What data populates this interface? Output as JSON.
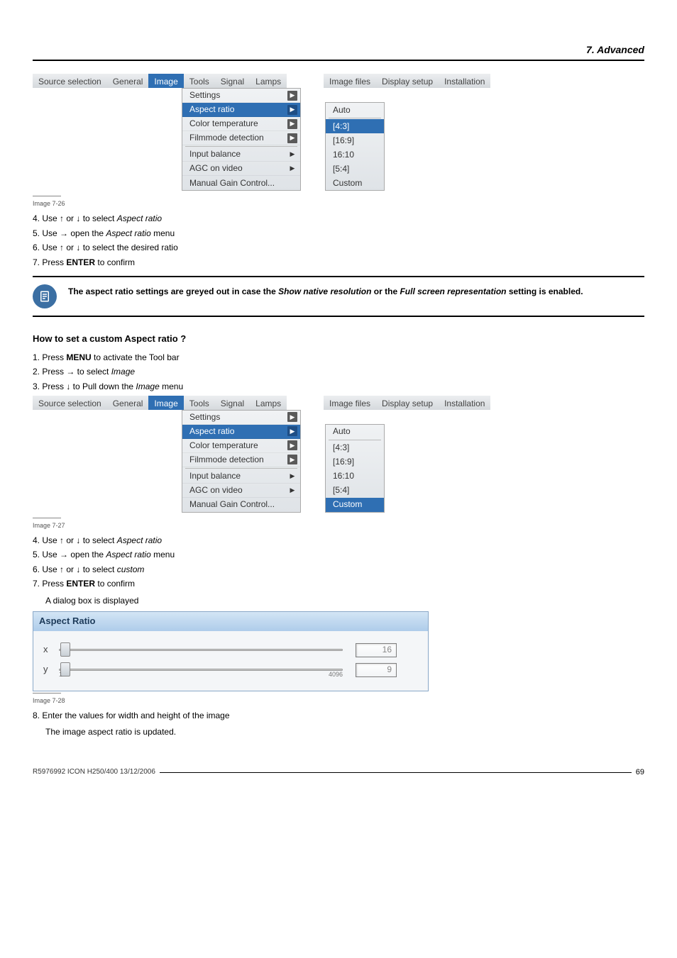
{
  "header": {
    "title": "7. Advanced"
  },
  "menubar": {
    "items_left": [
      "Source selection",
      "General"
    ],
    "highlight": "Image",
    "items_mid": [
      "Tools",
      "Signal",
      "Lamps"
    ],
    "items_right": [
      "Image files",
      "Display setup",
      "Installation"
    ]
  },
  "image_dropdown": {
    "settings": "Settings",
    "aspect": "Aspect ratio",
    "color_temp": "Color temperature",
    "filmmode": "Filmmode detection",
    "input_balance": "Input balance",
    "agc": "AGC on video",
    "manual_gain": "Manual Gain Control..."
  },
  "aspect_submenu_26": {
    "auto": "Auto",
    "r43": "[4:3]",
    "r169": "[16:9]",
    "r1610": "16:10",
    "r54": "[5:4]",
    "custom": "Custom"
  },
  "aspect_submenu_27": {
    "auto": "Auto",
    "r43": "[4:3]",
    "r169": "[16:9]",
    "r1610": "16:10",
    "r54": "[5:4]",
    "custom": "Custom"
  },
  "captions": {
    "c26": "Image 7-26",
    "c27": "Image 7-27",
    "c28": "Image 7-28"
  },
  "steps26": {
    "s4": "4.  Use ↑ or ↓ to select",
    "s4_ital": "Aspect ratio",
    "s5a": "5.  Use → open the ",
    "s5_ital": "Aspect ratio",
    "s5b": " menu",
    "s6": "6.  Use ↑ or ↓ to select the desired ratio",
    "s7a": "7.  Press ",
    "s7_bold": "ENTER",
    "s7b": " to confirm"
  },
  "note": {
    "line1": "The aspect ratio settings are greyed out in case the ",
    "ital1": "Show native resolution",
    "mid": " or the ",
    "ital2": "Full screen representation",
    "line2": " setting is enabled."
  },
  "section_title": "How to set a custom Aspect ratio ?",
  "steps_custom_top": {
    "s1a": "1.  Press ",
    "s1_bold": "MENU",
    "s1b": " to activate the Tool bar",
    "s2a": "2.  Press → to select ",
    "s2_ital": "Image",
    "s3a": "3.  Press ↓ to Pull down the ",
    "s3_ital": "Image",
    "s3b": " menu"
  },
  "steps_custom_bottom": {
    "s4": "4.  Use ↑ or ↓ to select ",
    "s4_ital": "Aspect ratio",
    "s5a": "5.  Use → open the ",
    "s5_ital": "Aspect ratio",
    "s5b": " menu",
    "s6": "6.  Use ↑ or ↓ to select ",
    "s6_ital": "custom",
    "s7a": "7.  Press ",
    "s7_bold": "ENTER",
    "s7b": " to confirm",
    "s7_sub": "A dialog box is displayed"
  },
  "ar_dialog": {
    "title": "Aspect Ratio",
    "x_label": "x",
    "y_label": "y",
    "x_tick_min": "",
    "x_tick_max": "",
    "y_tick_min": "1",
    "y_tick_max": "4096",
    "x_value": "16",
    "y_value": "9"
  },
  "steps_after_dialog": {
    "s8": "8.  Enter the values for width and height of the image",
    "s8_sub": "The image aspect ratio is updated."
  },
  "footer": {
    "left": "R5976992  ICON H250/400  13/12/2006",
    "page": "69"
  }
}
